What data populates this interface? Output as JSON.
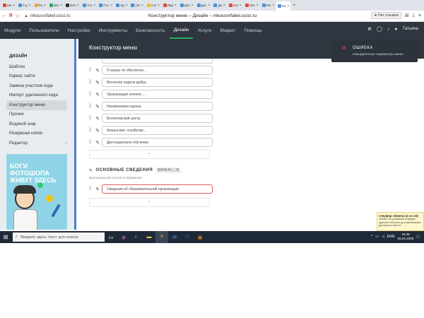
{
  "browser": {
    "tabs": [
      {
        "label": "Ми",
        "color": "#e24a3b"
      },
      {
        "label": "5 д",
        "color": "#4a90d9"
      },
      {
        "label": "Ра",
        "color": "#f5a623"
      },
      {
        "label": "Зен",
        "color": "#27ae60"
      },
      {
        "label": "Без",
        "color": "#333333"
      },
      {
        "label": "Что",
        "color": "#4a90d9"
      },
      {
        "label": "Пос",
        "color": "#4a90d9"
      },
      {
        "label": "Зд",
        "color": "#4a90d9"
      },
      {
        "label": "(10",
        "color": "#4a90d9"
      },
      {
        "label": "2 м",
        "color": "#f1c40f"
      },
      {
        "label": "Яид",
        "color": "#e24a3b"
      },
      {
        "label": "Дос",
        "color": "#4a90d9"
      },
      {
        "label": "Дос",
        "color": "#4a90d9"
      },
      {
        "label": "Ди",
        "color": "#4a90d9"
      },
      {
        "label": "клк",
        "color": "#e24a3b"
      },
      {
        "label": "Эле",
        "color": "#e24a3b"
      },
      {
        "label": "We",
        "color": "#4a90d9"
      },
      {
        "label": "Ко",
        "color": "#4a90d9",
        "active": true
      }
    ],
    "new_tab": "+",
    "url": "mkoucvrfakel.ucoz.ru",
    "title": "Конструктор меню – Дизайн – mkoucvrfakel.ucoz.ru",
    "reviews_label": "Нет отзывов"
  },
  "appnav": {
    "items": [
      {
        "label": "Модули"
      },
      {
        "label": "Пользователи"
      },
      {
        "label": "Настройки"
      },
      {
        "label": "Инструменты"
      },
      {
        "label": "Безопасность"
      },
      {
        "label": "Дизайн",
        "active": true
      },
      {
        "label": "Услуги"
      },
      {
        "label": "Маркет"
      },
      {
        "label": "Помощь"
      }
    ],
    "user": "Татьяна"
  },
  "sidebar": {
    "title": "ДИЗАЙН",
    "items": [
      {
        "label": "Шаблон"
      },
      {
        "label": "Каркас сайта"
      },
      {
        "label": "Замена участков кода"
      },
      {
        "label": "Импорт удаленного кода"
      },
      {
        "label": "Конструктор меню",
        "active": true
      },
      {
        "label": "Прочее"
      },
      {
        "label": "Водяной знак"
      },
      {
        "label": "Резервная копия"
      },
      {
        "label": "Редактор",
        "has_arrow": true
      }
    ],
    "promo": [
      "БОГИ",
      "ФОТОШОПА",
      "ЖИВУТ ЗДЕСЬ"
    ]
  },
  "main": {
    "title": "Конструктор меню",
    "menu_items": [
      {
        "label": "О мерах по обеспечен..."
      },
      {
        "label": "Весенняя неделя добра"
      },
      {
        "label": "Организация летнего ..."
      },
      {
        "label": "Независимая оценка"
      },
      {
        "label": "Волонтерский центр"
      },
      {
        "label": "Финансово- хозяйстве..."
      },
      {
        "label": "Дистанционное обучение"
      }
    ],
    "add_symbol": "+",
    "section": {
      "title": "ОСНОВНЫЕ СВЕДЕНИЯ",
      "badge": "$MMENU_1$",
      "subtitle": "Вертикальный способ отображения",
      "items": [
        {
          "label": "Сведения об образовательной организации"
        }
      ]
    }
  },
  "error": {
    "title": "ОШИБКА",
    "message": "Некорректные параметры меню"
  },
  "clipboard": {
    "title": "Буфер обмена (2 из 24)",
    "text": "Объект не добавлен в буфер: удалите объекты для увеличения доступного места"
  },
  "taskbar": {
    "search_placeholder": "Введите здесь текст для поиска",
    "lang": "ENG",
    "time": "16:49",
    "date": "06.04.2025"
  }
}
